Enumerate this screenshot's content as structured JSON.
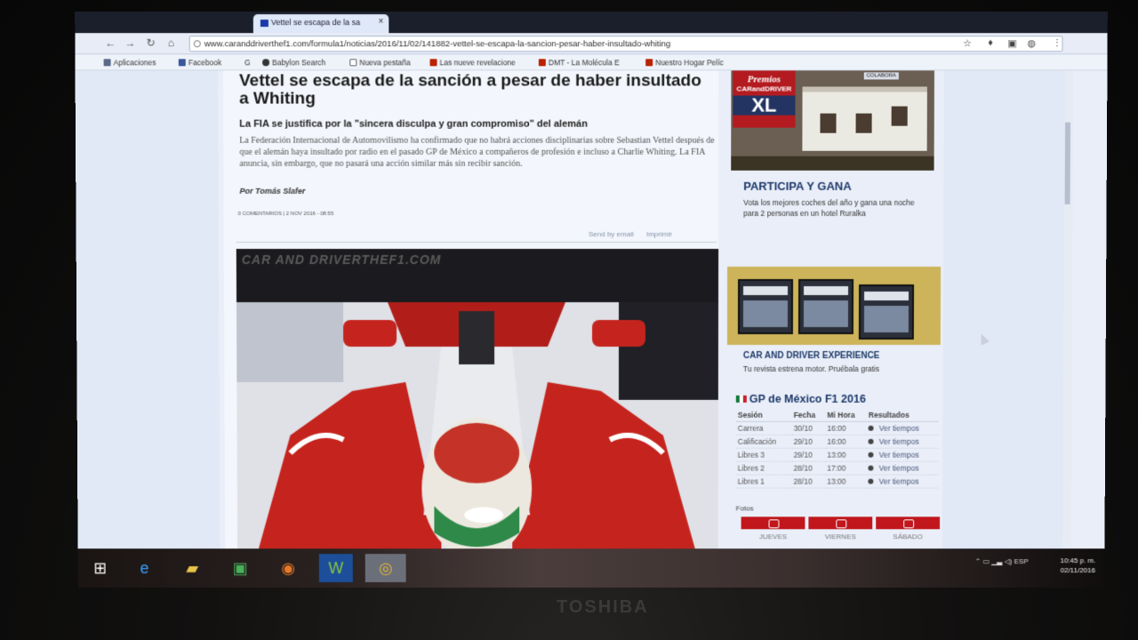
{
  "browser": {
    "tab_title": "Vettel se escapa de la sa",
    "url": "www.caranddriverthef1.com/formula1/noticias/2016/11/02/141882-vettel-se-escapa-la-sancion-pesar-haber-insultado-whiting",
    "bookmarks": [
      "Aplicaciones",
      "Facebook",
      "G",
      "Babylon Search",
      "Nueva pestaña",
      "Las nueve revelacione",
      "DMT - La Molécula E",
      "Nuestro Hogar Pelíc"
    ]
  },
  "article": {
    "title": "Vettel se escapa de la sanción a pesar de haber insultado a Whiting",
    "subtitle": "La FIA se justifica por la \"sincera disculpa y gran compromiso\" del alemán",
    "lead": "La Federación Internacional de Automovilismo ha confirmado que no habrá acciones disciplinarias sobre Sebastian Vettel después de que el alemán haya insultado por radio en el pasado GP de México a compañeros de profesión e incluso a Charlie Whiting. La FIA anuncia, sin embargo, que no pasará una acción similar más sin recibir sanción.",
    "author": "Por Tomás Slafer",
    "meta": "0 COMENTARIOS | 2 NOV 2016 - 08:55",
    "share_email": "Send by email",
    "share_print": "Imprimir",
    "photo_watermark": "CAR AND DRIVERTHEF1.COM"
  },
  "sidebar": {
    "promo_badge_top": "Premios",
    "promo_badge_brand": "CARandDRIVER",
    "promo_badge_xl": "XL",
    "promo_tag": "COLABORA",
    "participa_title": "PARTICIPA Y GANA",
    "participa_text": "Vota los mejores coches del año y gana una noche para 2 personas en un hotel Ruralka",
    "experience_title": "CAR AND DRIVER EXPERIENCE",
    "experience_text": "Tu revista estrena motor. Pruébala gratis",
    "gp_title": "GP de México F1 2016",
    "gp_headers": [
      "Sesión",
      "Fecha",
      "Mi Hora",
      "Resultados"
    ],
    "gp_rows": [
      {
        "session": "Carrera",
        "date": "30/10",
        "time": "16:00",
        "result": "Ver tiempos"
      },
      {
        "session": "Calificación",
        "date": "29/10",
        "time": "16:00",
        "result": "Ver tiempos"
      },
      {
        "session": "Libres 3",
        "date": "29/10",
        "time": "13:00",
        "result": "Ver tiempos"
      },
      {
        "session": "Libres 2",
        "date": "28/10",
        "time": "17:00",
        "result": "Ver tiempos"
      },
      {
        "session": "Libres 1",
        "date": "28/10",
        "time": "13:00",
        "result": "Ver tiempos"
      }
    ],
    "fotos_label": "Fotos",
    "days": [
      "JUEVES",
      "VIERNES",
      "SÁBADO"
    ]
  },
  "taskbar": {
    "icons": [
      "windows-icon",
      "ie-icon",
      "explorer-icon",
      "store-icon",
      "media-icon",
      "word-icon",
      "chrome-icon"
    ],
    "tray": "ESP",
    "time": "10:45 p. m.",
    "date": "02/11/2016"
  },
  "monitor_brand": "TOSHIBA",
  "colors": {
    "accent_red": "#c0161c",
    "heading_blue": "#1e3a6a"
  }
}
